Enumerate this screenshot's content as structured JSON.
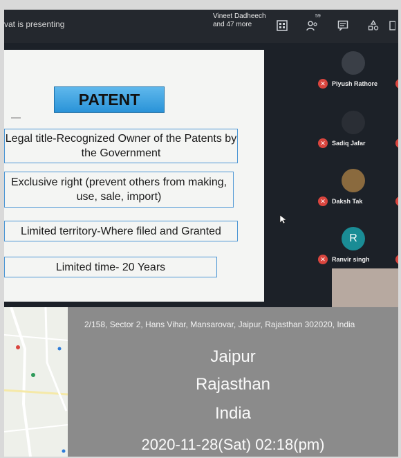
{
  "meet": {
    "presenting_text": "vat is presenting",
    "people": {
      "line1": "Vineet Dadheech",
      "line2": "and 47 more"
    },
    "participant_count": "59",
    "toolbar_icons": [
      "layout-icon",
      "people-icon",
      "chat-icon",
      "activities-icon",
      "more-icon"
    ]
  },
  "slide": {
    "title": "PATENT",
    "items": [
      "Legal title-Recognized Owner of the Patents by the Government",
      "Exclusive right  (prevent others from making, use, sale, import)",
      "Limited territory-Where filed and Granted",
      "Limited time- 20 Years"
    ]
  },
  "participants": [
    {
      "name": "Piyush Rathore",
      "avatar_color": "#3a3f47"
    },
    {
      "name": "Sadiq Jafar",
      "avatar_color": "#2a2e35"
    },
    {
      "name": "Daksh Tak",
      "avatar_color": "#8a6a3e"
    },
    {
      "name": "Ranvir singh",
      "initial": "R",
      "avatar_color": "#1a8c95"
    }
  ],
  "stamp": {
    "address": "2/158, Sector 2, Hans Vihar, Mansarovar, Jaipur, Rajasthan 302020, India",
    "city": "Jaipur",
    "state": "Rajasthan",
    "country": "India",
    "datetime": "2020-11-28(Sat)   02:18(pm)"
  },
  "colors": {
    "mic_red": "#d9453e",
    "title_blue": "#2a93d8",
    "box_border": "#4e97d5"
  }
}
